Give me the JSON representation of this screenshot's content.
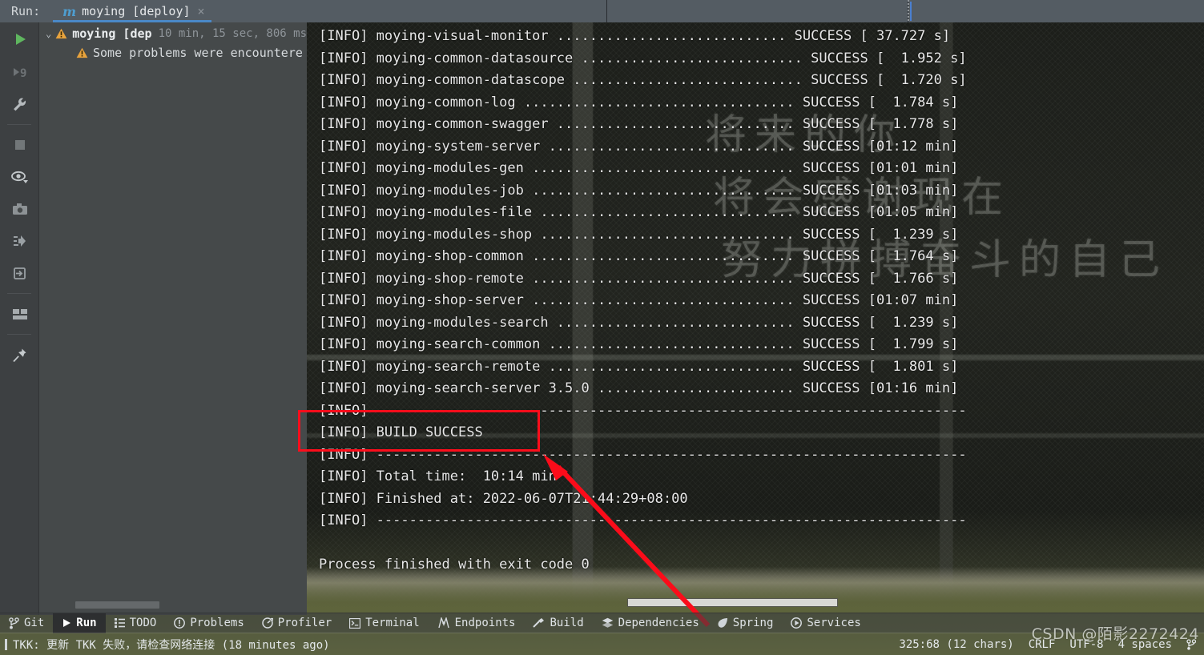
{
  "topbar": {
    "run_label": "Run:",
    "tab": {
      "icon_name": "maven-m-icon",
      "icon_glyph": "m",
      "title": "moying [deploy]",
      "close_glyph": "×"
    }
  },
  "icon_rail": [
    {
      "name": "run-icon",
      "title": "Run"
    },
    {
      "name": "rerun-failed-icon",
      "title": "Rerun failed"
    },
    {
      "name": "wrench-settings-icon",
      "title": "Settings"
    },
    {
      "name": "stop-icon",
      "title": "Stop"
    },
    {
      "name": "eye-filter-icon",
      "title": "Filter"
    },
    {
      "name": "camera-soft-wrap-icon",
      "title": "Soft-Wrap"
    },
    {
      "name": "scroll-to-end-icon",
      "title": "Scroll to end"
    },
    {
      "name": "print-export-icon",
      "title": "Export"
    },
    {
      "name": "layout-icon",
      "title": "Layout"
    },
    {
      "name": "pin-icon",
      "title": "Pin tab"
    }
  ],
  "tree": {
    "chevron": "⌄",
    "root": {
      "name": "moying [dep",
      "duration": "10 min, 15 sec, 806 ms"
    },
    "child": {
      "text": "Some problems were encountere"
    }
  },
  "console": {
    "lines": [
      "[INFO] moying-visual-monitor ............................ SUCCESS [ 37.727 s]",
      "[INFO] moying-common-datasource ........................... SUCCESS [  1.952 s]",
      "[INFO] moying-common-datascope ............................ SUCCESS [  1.720 s]",
      "[INFO] moying-common-log ................................. SUCCESS [  1.784 s]",
      "[INFO] moying-common-swagger ............................. SUCCESS [  1.778 s]",
      "[INFO] moying-system-server .............................. SUCCESS [01:12 min]",
      "[INFO] moying-modules-gen ................................ SUCCESS [01:01 min]",
      "[INFO] moying-modules-job ................................ SUCCESS [01:03 min]",
      "[INFO] moying-modules-file ............................... SUCCESS [01:05 min]",
      "[INFO] moying-modules-shop ............................... SUCCESS [  1.239 s]",
      "[INFO] moying-shop-common ................................ SUCCESS [  1.764 s]",
      "[INFO] moying-shop-remote ................................ SUCCESS [  1.766 s]",
      "[INFO] moying-shop-server ................................ SUCCESS [01:07 min]",
      "[INFO] moying-modules-search ............................. SUCCESS [  1.239 s]",
      "[INFO] moying-search-common .............................. SUCCESS [  1.799 s]",
      "[INFO] moying-search-remote .............................. SUCCESS [  1.801 s]",
      "[INFO] moying-search-server 3.5.0 ........................ SUCCESS [01:16 min]",
      "[INFO] ------------------------------------------------------------------------",
      "[INFO] BUILD SUCCESS",
      "[INFO] ------------------------------------------------------------------------",
      "[INFO] Total time:  10:14 min",
      "[INFO] Finished at: 2022-06-07T21:44:29+08:00",
      "[INFO] ------------------------------------------------------------------------",
      "",
      "Process finished with exit code 0"
    ]
  },
  "background": {
    "calligraphy_line1": "将来的你",
    "calligraphy_line2": "将会感谢现在",
    "calligraphy_line3": "努力拼搏奋斗的自己"
  },
  "annotations": {
    "highlight_target": "BUILD SUCCESS",
    "box_color": "#fc0d1b",
    "arrow_color": "#fb0c1a"
  },
  "toolbar": {
    "items": [
      {
        "label": "Git",
        "icon": "git-branch-icon",
        "active": false
      },
      {
        "label": "Run",
        "icon": "run-play-icon",
        "active": true
      },
      {
        "label": "TODO",
        "icon": "todo-list-icon",
        "active": false
      },
      {
        "label": "Problems",
        "icon": "problems-exclamation-icon",
        "active": false
      },
      {
        "label": "Profiler",
        "icon": "profiler-gauge-icon",
        "active": false
      },
      {
        "label": "Terminal",
        "icon": "terminal-icon",
        "active": false
      },
      {
        "label": "Endpoints",
        "icon": "endpoints-icon",
        "active": false
      },
      {
        "label": "Build",
        "icon": "build-hammer-icon",
        "active": false
      },
      {
        "label": "Dependencies",
        "icon": "dependencies-layers-icon",
        "active": false
      },
      {
        "label": "Spring",
        "icon": "spring-leaf-icon",
        "active": false
      },
      {
        "label": "Services",
        "icon": "services-play-icon",
        "active": false
      }
    ]
  },
  "statusbar": {
    "message": "TKK: 更新 TKK 失败，请检查网络连接 (18 minutes ago)",
    "caret_position": "325:68 (12 chars)",
    "line_separator": "CRLF",
    "encoding": "UTF-8",
    "indent": "4 spaces",
    "branch_icon": "git-branch-icon",
    "watermark": "CSDN @陌影2272424"
  }
}
